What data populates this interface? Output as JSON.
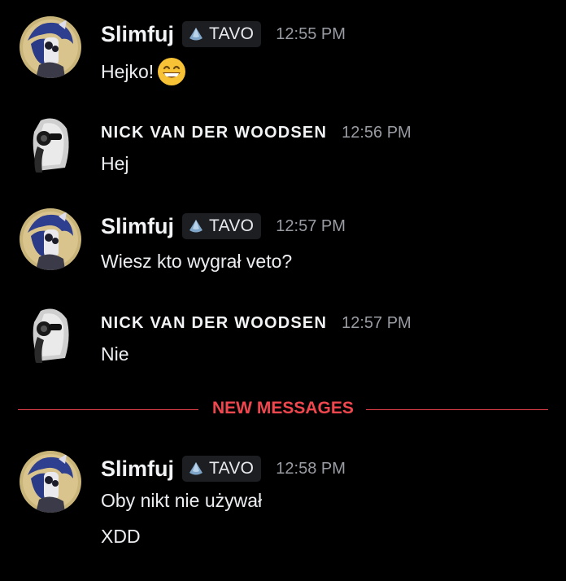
{
  "messages": [
    {
      "author": "Slimfuj",
      "tag": "TAVO",
      "time": "12:55 PM",
      "lines": [
        "Hejko!"
      ]
    },
    {
      "author": "NICK VAN DER WOODSEN",
      "time": "12:56 PM",
      "lines": [
        "Hej"
      ]
    },
    {
      "author": "Slimfuj",
      "tag": "TAVO",
      "time": "12:57 PM",
      "lines": [
        "Wiesz kto wygrał veto?"
      ]
    },
    {
      "author": "NICK VAN DER WOODSEN",
      "time": "12:57 PM",
      "lines": [
        "Nie"
      ]
    },
    {
      "author": "Slimfuj",
      "tag": "TAVO",
      "time": "12:58 PM",
      "lines": [
        "Oby nikt nie używał",
        "XDD"
      ]
    }
  ],
  "divider": {
    "label": "NEW MESSAGES"
  },
  "colors": {
    "background": "#000000",
    "accent_red": "#f0474f",
    "timestamp": "#9a9ca3",
    "tag_bg": "#1d1e22"
  },
  "icons": {
    "tag_icon": "water-drop-icon",
    "emoji": "grinning-smile-emoji"
  }
}
